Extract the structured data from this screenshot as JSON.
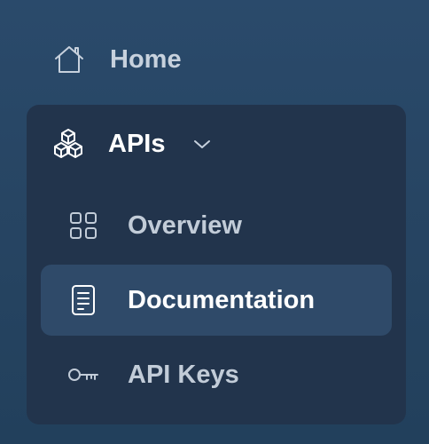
{
  "nav": {
    "home": {
      "label": "Home",
      "icon": "home-icon"
    },
    "apis": {
      "label": "APIs",
      "icon": "cubes-icon",
      "expanded": true,
      "items": [
        {
          "label": "Overview",
          "icon": "grid-icon",
          "active": false
        },
        {
          "label": "Documentation",
          "icon": "document-icon",
          "active": true
        },
        {
          "label": "API Keys",
          "icon": "key-icon",
          "active": false
        }
      ]
    }
  },
  "colors": {
    "background": "#274563",
    "group_background": "#22344c",
    "active_background": "#2f4a69",
    "text_muted": "#c2ccd8",
    "text_active": "#ffffff"
  }
}
